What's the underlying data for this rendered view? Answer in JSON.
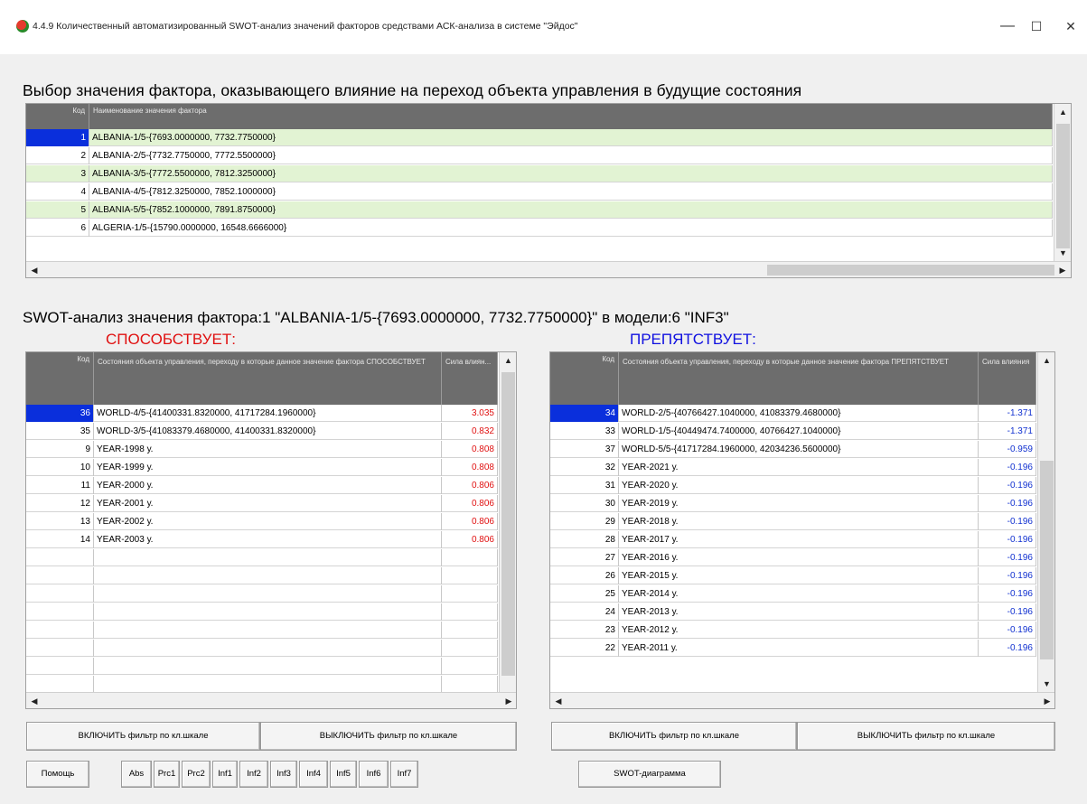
{
  "window": {
    "title": "4.4.9 Количественный автоматизированный SWOT-анализ значений факторов средствами АСК-анализа в системе \"Эйдос\"",
    "minimize": "—",
    "maximize": "☐",
    "close": "✕"
  },
  "factor_section": {
    "heading": "Выбор значения фактора, оказывающего влияние на переход объекта управления в будущие состояния",
    "col_code": "Код",
    "col_name": "Наименование значения фактора",
    "rows": [
      {
        "code": "1",
        "name": "ALBANIA-1/5-{7693.0000000, 7732.7750000}"
      },
      {
        "code": "2",
        "name": "ALBANIA-2/5-{7732.7750000, 7772.5500000}"
      },
      {
        "code": "3",
        "name": "ALBANIA-3/5-{7772.5500000, 7812.3250000}"
      },
      {
        "code": "4",
        "name": "ALBANIA-4/5-{7812.3250000, 7852.1000000}"
      },
      {
        "code": "5",
        "name": "ALBANIA-5/5-{7852.1000000, 7891.8750000}"
      },
      {
        "code": "6",
        "name": "ALGERIA-1/5-{15790.0000000, 16548.6666000}"
      }
    ]
  },
  "swot": {
    "heading": "SWOT-анализ значения фактора:1 \"ALBANIA-1/5-{7693.0000000, 7732.7750000}\" в модели:6 \"INF3\"",
    "promotes_label": "СПОСОБСТВУЕТ:",
    "hinders_label": "ПРЕПЯТСТВУЕТ:",
    "left": {
      "col_code": "Код",
      "col_name": "Состояния объекта управления, переходу в которые данное значение фактора СПОСОБСТВУЕТ",
      "col_value": "Сила влиян...",
      "rows": [
        {
          "code": "36",
          "name": "WORLD-4/5-{41400331.8320000, 41717284.1960000}",
          "value": "3.035"
        },
        {
          "code": "35",
          "name": "WORLD-3/5-{41083379.4680000, 41400331.8320000}",
          "value": "0.832"
        },
        {
          "code": "9",
          "name": "YEAR-1998 у.",
          "value": "0.808"
        },
        {
          "code": "10",
          "name": "YEAR-1999 у.",
          "value": "0.808"
        },
        {
          "code": "11",
          "name": "YEAR-2000 у.",
          "value": "0.806"
        },
        {
          "code": "12",
          "name": "YEAR-2001 у.",
          "value": "0.806"
        },
        {
          "code": "13",
          "name": "YEAR-2002 у.",
          "value": "0.806"
        },
        {
          "code": "14",
          "name": "YEAR-2003 у.",
          "value": "0.806"
        }
      ]
    },
    "right": {
      "col_code": "Код",
      "col_name": "Состояния объекта управления, переходу в которые данное значение фактора ПРЕПЯТСТВУЕТ",
      "col_value": "Сила влияния",
      "rows": [
        {
          "code": "34",
          "name": "WORLD-2/5-{40766427.1040000, 41083379.4680000}",
          "value": "-1.371"
        },
        {
          "code": "33",
          "name": "WORLD-1/5-{40449474.7400000, 40766427.1040000}",
          "value": "-1.371"
        },
        {
          "code": "37",
          "name": "WORLD-5/5-{41717284.1960000, 42034236.5600000}",
          "value": "-0.959"
        },
        {
          "code": "32",
          "name": "YEAR-2021 у.",
          "value": "-0.196"
        },
        {
          "code": "31",
          "name": "YEAR-2020 у.",
          "value": "-0.196"
        },
        {
          "code": "30",
          "name": "YEAR-2019 у.",
          "value": "-0.196"
        },
        {
          "code": "29",
          "name": "YEAR-2018 у.",
          "value": "-0.196"
        },
        {
          "code": "28",
          "name": "YEAR-2017 у.",
          "value": "-0.196"
        },
        {
          "code": "27",
          "name": "YEAR-2016 у.",
          "value": "-0.196"
        },
        {
          "code": "26",
          "name": "YEAR-2015 у.",
          "value": "-0.196"
        },
        {
          "code": "25",
          "name": "YEAR-2014 у.",
          "value": "-0.196"
        },
        {
          "code": "24",
          "name": "YEAR-2013 у.",
          "value": "-0.196"
        },
        {
          "code": "23",
          "name": "YEAR-2012 у.",
          "value": "-0.196"
        },
        {
          "code": "22",
          "name": "YEAR-2011 у.",
          "value": "-0.196"
        }
      ]
    }
  },
  "buttons": {
    "filter_on": "ВКЛЮЧИТЬ фильтр по кл.шкале",
    "filter_off": "ВЫКЛЮЧИТЬ фильтр по кл.шкале",
    "help": "Помощь",
    "models": [
      "Abs",
      "Prc1",
      "Prc2",
      "Inf1",
      "Inf2",
      "Inf3",
      "Inf4",
      "Inf5",
      "Inf6",
      "Inf7"
    ],
    "swot_diagram": "SWOT-диаграмма"
  },
  "colors": {
    "selected": "#0a2fdc",
    "row_green": "#e2f3d3",
    "promotes": "#e01010",
    "hinders": "#1010e0"
  }
}
